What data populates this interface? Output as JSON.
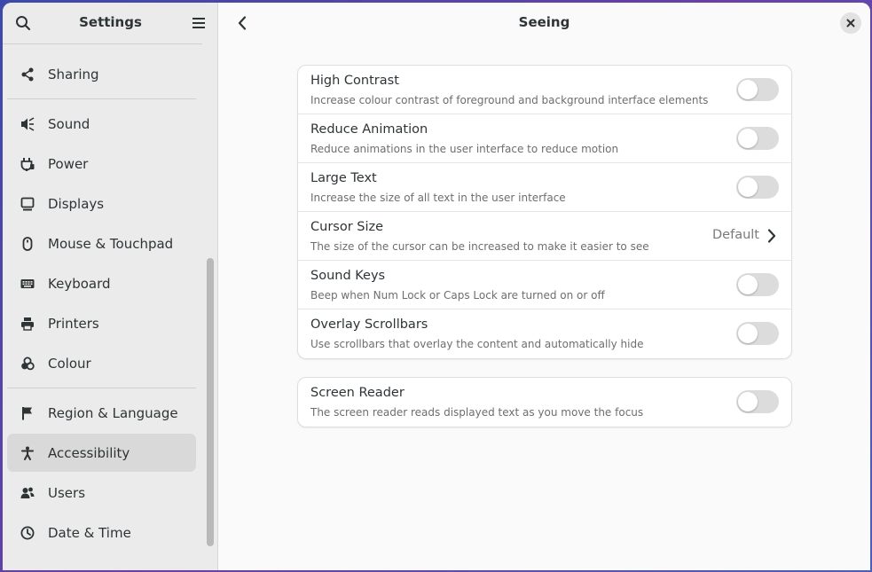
{
  "sidebar": {
    "title": "Settings",
    "items": [
      {
        "label": "Sharing",
        "icon": "share-icon",
        "active": false
      },
      {
        "label": "Sound",
        "icon": "speaker-icon",
        "active": false
      },
      {
        "label": "Power",
        "icon": "power-plug-icon",
        "active": false
      },
      {
        "label": "Displays",
        "icon": "display-icon",
        "active": false
      },
      {
        "label": "Mouse & Touchpad",
        "icon": "mouse-icon",
        "active": false
      },
      {
        "label": "Keyboard",
        "icon": "keyboard-icon",
        "active": false
      },
      {
        "label": "Printers",
        "icon": "printer-icon",
        "active": false
      },
      {
        "label": "Colour",
        "icon": "colour-icon",
        "active": false
      },
      {
        "label": "Region & Language",
        "icon": "flag-icon",
        "active": false
      },
      {
        "label": "Accessibility",
        "icon": "accessibility-icon",
        "active": true
      },
      {
        "label": "Users",
        "icon": "users-icon",
        "active": false
      },
      {
        "label": "Date & Time",
        "icon": "clock-icon",
        "active": false
      }
    ]
  },
  "main": {
    "title": "Seeing",
    "group1": [
      {
        "title": "High Contrast",
        "subtitle": "Increase colour contrast of foreground and background interface elements",
        "type": "switch",
        "on": false
      },
      {
        "title": "Reduce Animation",
        "subtitle": "Reduce animations in the user interface to reduce motion",
        "type": "switch",
        "on": false
      },
      {
        "title": "Large Text",
        "subtitle": "Increase the size of all text in the user interface",
        "type": "switch",
        "on": false
      },
      {
        "title": "Cursor Size",
        "subtitle": "The size of the cursor can be increased to make it easier to see",
        "type": "link",
        "value": "Default"
      },
      {
        "title": "Sound Keys",
        "subtitle": "Beep when Num Lock or Caps Lock are turned on or off",
        "type": "switch",
        "on": false
      },
      {
        "title": "Overlay Scrollbars",
        "subtitle": "Use scrollbars that overlay the content and automatically hide",
        "type": "switch",
        "on": false
      }
    ],
    "group2": [
      {
        "title": "Screen Reader",
        "subtitle": "The screen reader reads displayed text as you move the focus",
        "type": "switch",
        "on": false
      }
    ]
  },
  "colors": {
    "accent": "#3584e4",
    "sidebar_bg": "#ebebeb",
    "active_item_bg": "#d9d9d9",
    "switch_off": "#dcdcdc"
  }
}
